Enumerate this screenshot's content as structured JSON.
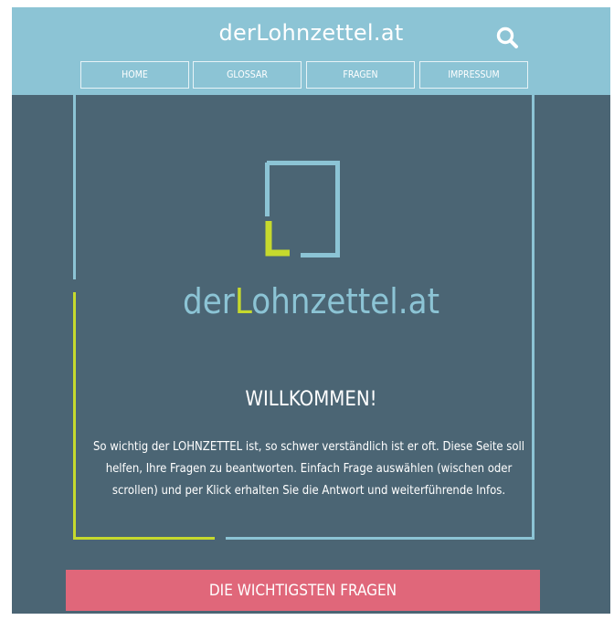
{
  "header": {
    "site_title": "derLohnzettel.at",
    "search_icon": "search-icon"
  },
  "nav": {
    "items": [
      {
        "label": "Home"
      },
      {
        "label": "Glossar"
      },
      {
        "label": "Fragen"
      },
      {
        "label": "Impressum"
      }
    ]
  },
  "logo": {
    "prefix": "der",
    "accent_letter": "L",
    "suffix": "ohnzettel.at"
  },
  "welcome": {
    "title": "WILLKOMMEN!",
    "text": "So wichtig der LOHNZETTEL ist, so schwer verständlich ist er oft. Diese Seite soll helfen, Ihre Fragen zu beantworten. Einfach Frage auswählen (wischen oder scrollen) und per Klick erhalten Sie die Antwort und weiterführende Infos."
  },
  "cta": {
    "label": "Die wichtigsten Fragen"
  },
  "colors": {
    "header_bg": "#8cc4d5",
    "page_bg": "#4b6574",
    "accent_green": "#c6d92d",
    "cta_bg": "#e0677a",
    "text": "#ffffff"
  }
}
